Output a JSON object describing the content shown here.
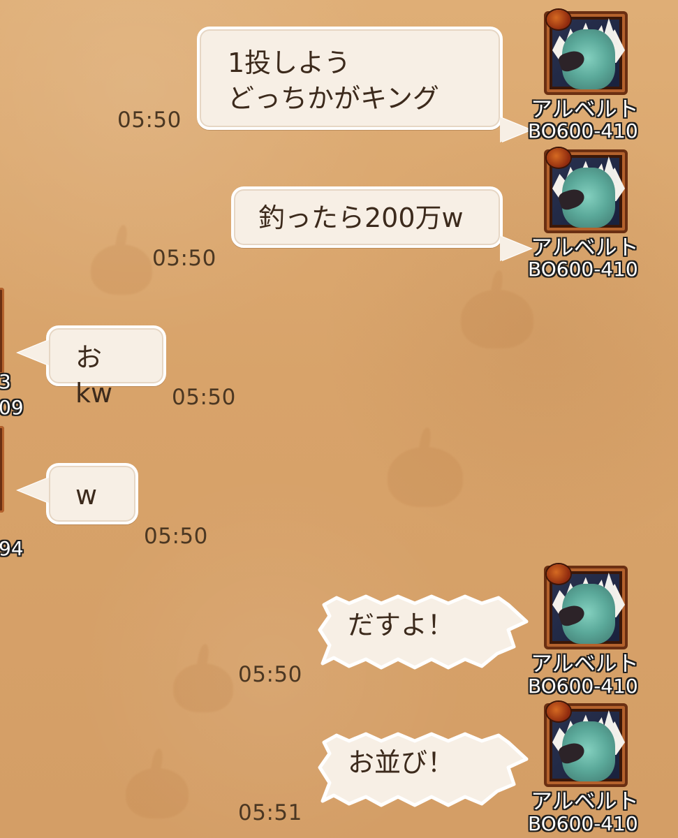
{
  "messages": [
    {
      "text": "1投しよう\nどっちかがキング",
      "time": "05:50",
      "avatar_name": "アルベルト",
      "avatar_id": "BO600-410"
    },
    {
      "text": "釣ったら200万w",
      "time": "05:50",
      "avatar_name": "アルベルト",
      "avatar_id": "BO600-410"
    },
    {
      "text": "おkw",
      "time": "05:50",
      "left_id": "09",
      "left_top_text": "3"
    },
    {
      "text": "w",
      "time": "05:50",
      "left_id": "94"
    },
    {
      "text": "だすよ！",
      "time": "05:50",
      "avatar_name": "アルベルト",
      "avatar_id": "BO600-410"
    },
    {
      "text": "お並び！",
      "time": "05:51",
      "avatar_name": "アルベルト",
      "avatar_id": "BO600-410"
    }
  ],
  "icons": {
    "avatar": "character-portrait-icon",
    "badge": "pumpkin-badge-icon"
  },
  "colors": {
    "background": "#d9a66c",
    "bubble": "#f7efe5",
    "text": "#3c2a1c"
  }
}
